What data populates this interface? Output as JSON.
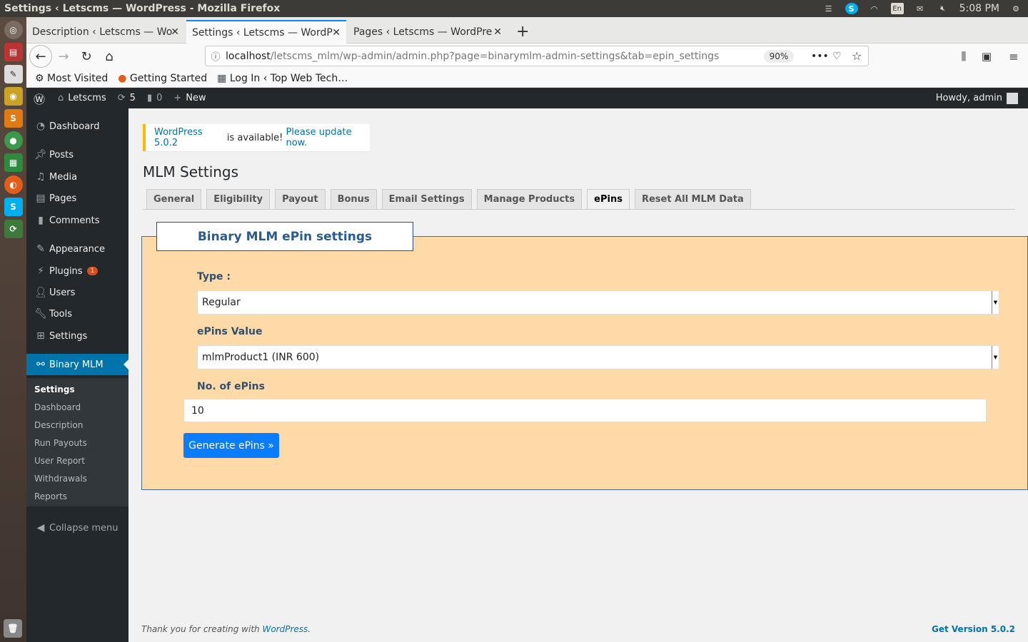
{
  "os": {
    "window_title": "Settings ‹ Letscms — WordPress - Mozilla Firefox",
    "keyboard": "En",
    "time": "5:08 PM"
  },
  "browser": {
    "tabs": [
      {
        "label": "Description ‹ Letscms — Wo"
      },
      {
        "label": "Settings ‹ Letscms — WordP"
      },
      {
        "label": "Pages ‹ Letscms — WordPre"
      }
    ],
    "url_host": "localhost",
    "url_path": "/letscms_mlm/wp-admin/admin.php?page=binarymlm-admin-settings&tab=epin_settings",
    "zoom": "90%",
    "bookmarks": [
      "Most Visited",
      "Getting Started",
      "Log In ‹ Top Web Tech…"
    ]
  },
  "adminbar": {
    "site": "Letscms",
    "updates": "5",
    "comments": "0",
    "new": "New",
    "howdy": "Howdy, admin"
  },
  "sidebar": {
    "items": [
      {
        "label": "Dashboard",
        "icon": "dashboard-icon"
      },
      {
        "label": "Posts",
        "icon": "pin-icon"
      },
      {
        "label": "Media",
        "icon": "media-icon"
      },
      {
        "label": "Pages",
        "icon": "pages-icon"
      },
      {
        "label": "Comments",
        "icon": "comment-icon"
      },
      {
        "label": "Appearance",
        "icon": "brush-icon"
      },
      {
        "label": "Plugins",
        "icon": "plugin-icon",
        "badge": "1"
      },
      {
        "label": "Users",
        "icon": "user-icon"
      },
      {
        "label": "Tools",
        "icon": "wrench-icon"
      },
      {
        "label": "Settings",
        "icon": "settings-icon"
      },
      {
        "label": "Binary MLM",
        "icon": "network-icon"
      }
    ],
    "submenu": [
      "Settings",
      "Dashboard",
      "Description",
      "Run Payouts",
      "User Report",
      "Withdrawals",
      "Reports"
    ],
    "collapse": "Collapse menu"
  },
  "notice": {
    "version_link": "WordPress 5.0.2",
    "text": " is available! ",
    "update_link": "Please update now."
  },
  "page": {
    "title": "MLM Settings",
    "tabs": [
      "General",
      "Eligibility",
      "Payout",
      "Bonus",
      "Email Settings",
      "Manage Products",
      "ePins",
      "Reset All MLM Data"
    ],
    "active_tab": "ePins"
  },
  "form": {
    "legend": "Binary MLM ePin settings",
    "type_label": "Type :",
    "type_value": "Regular",
    "value_label": "ePins Value",
    "value_value": "mlmProduct1 (INR 600)",
    "count_label": "No. of ePins",
    "count_value": "10",
    "submit": "Generate ePins »"
  },
  "footer": {
    "thanks": "Thank you for creating with ",
    "wp_link": "WordPress",
    "period": ".",
    "version": "Get Version 5.0.2"
  }
}
